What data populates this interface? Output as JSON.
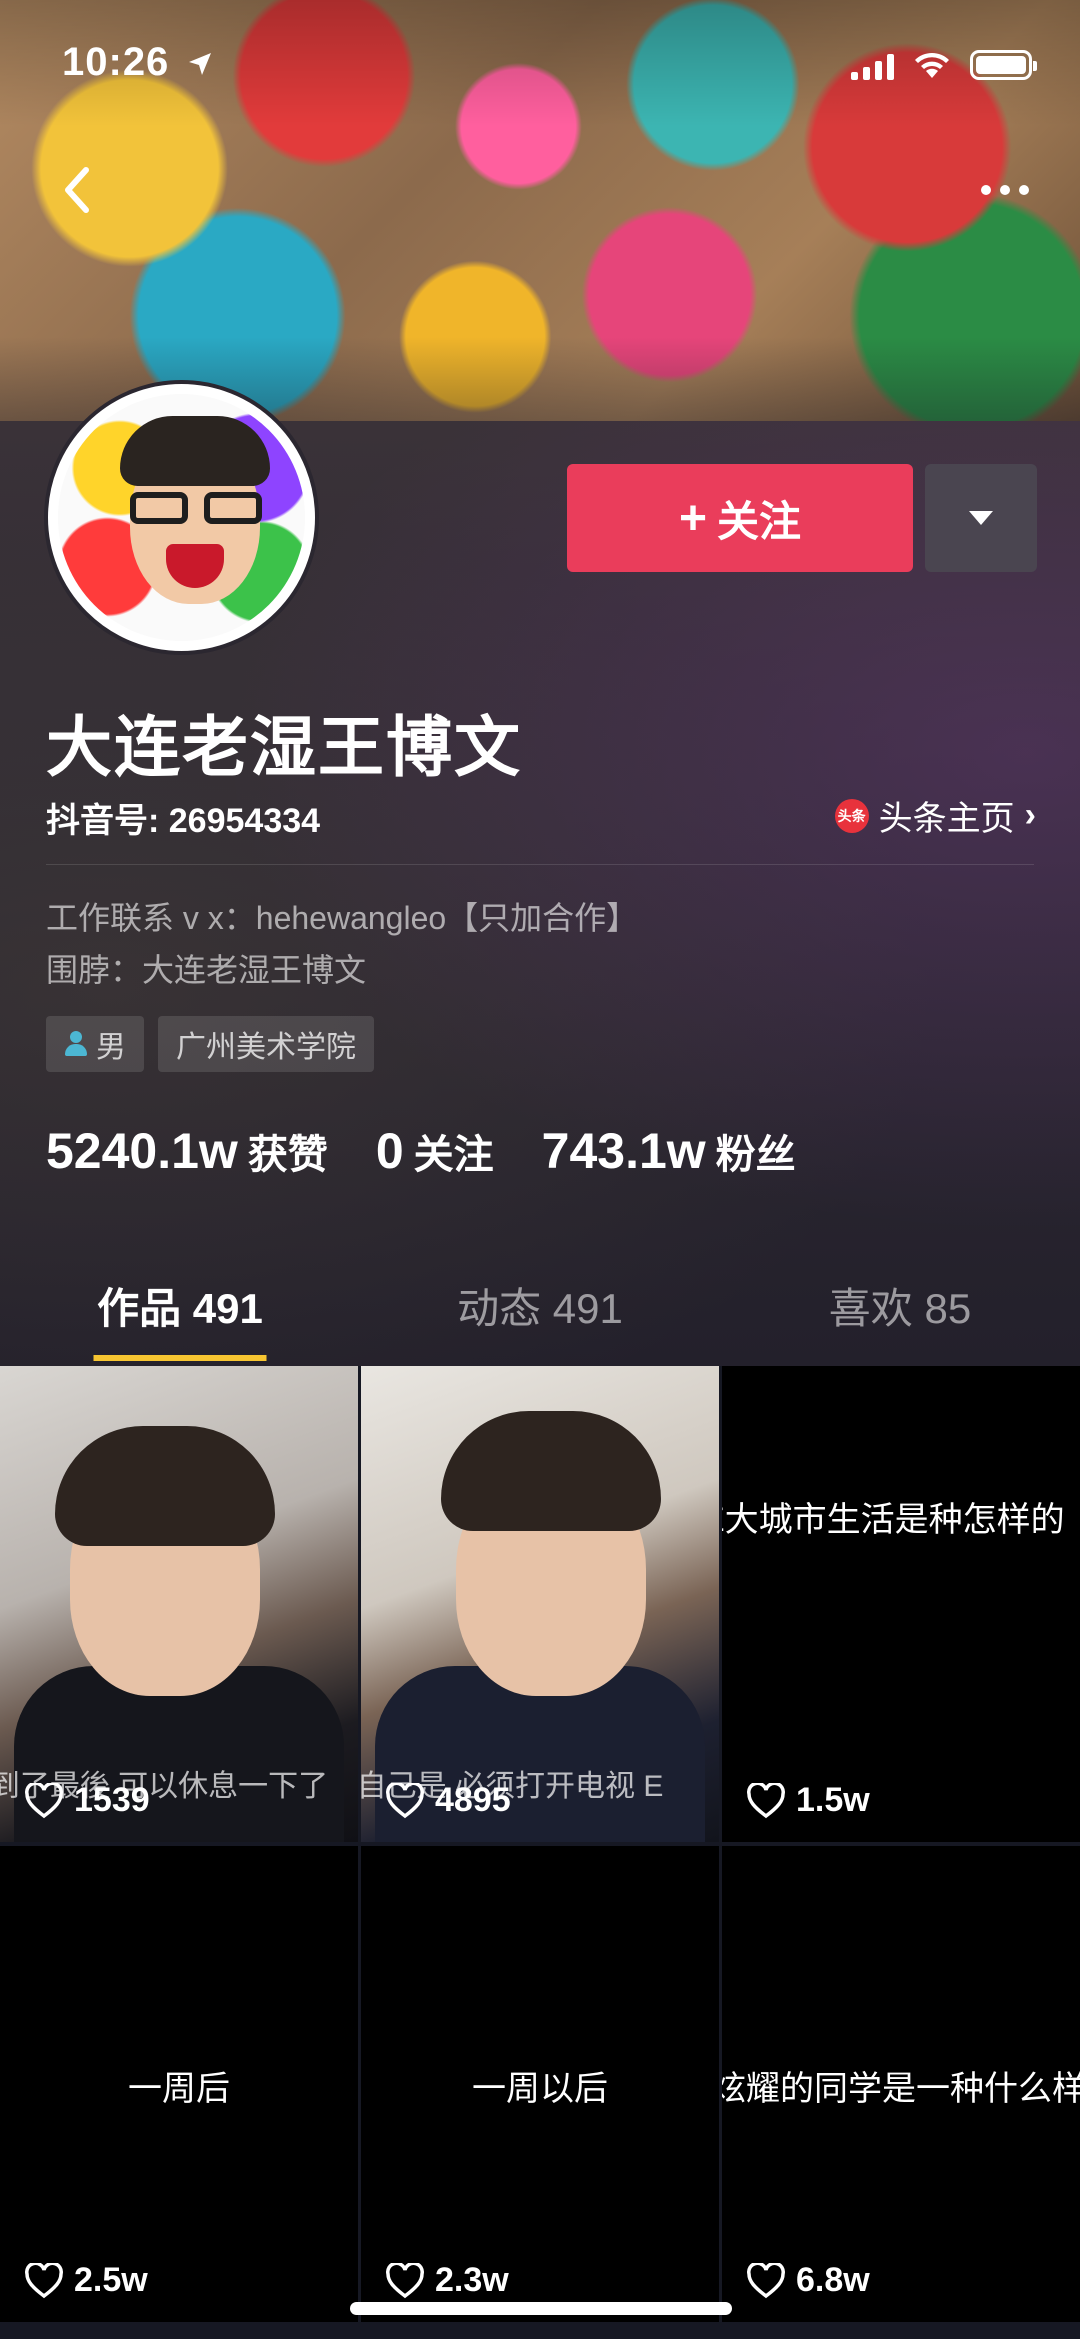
{
  "status_bar": {
    "time": "10:26"
  },
  "profile": {
    "name": "大连老湿王博文",
    "douyin_id": "抖音号: 26954334",
    "toutiao_icon_text": "头条",
    "toutiao_label": "头条主页",
    "bio_lines": [
      "工作联系 v x：hehewangleo【只加合作】",
      "围脖：大连老湿王博文"
    ],
    "tags": [
      "男",
      "广州美术学院"
    ],
    "follow_label": "关注",
    "follow_plus": "+"
  },
  "stats": [
    {
      "num": "5240.1w",
      "label": "获赞"
    },
    {
      "num": "0",
      "label": "关注"
    },
    {
      "num": "743.1w",
      "label": "粉丝"
    }
  ],
  "tabs": [
    {
      "label": "作品 491",
      "active": true
    },
    {
      "label": "动态 491",
      "active": false
    },
    {
      "label": "喜欢 85",
      "active": false
    }
  ],
  "videos": [
    {
      "likes": "1539",
      "caption": "到了最後 可以休息一下了"
    },
    {
      "likes": "4895",
      "caption": "自己是 必须打开电视 E"
    },
    {
      "likes": "1.5w",
      "caption": "E大城市生活是种怎样的"
    },
    {
      "likes": "2.5w",
      "caption": "一周后"
    },
    {
      "likes": "2.3w",
      "caption": "一周以后"
    },
    {
      "likes": "6.8w",
      "caption": "炫耀的同学是一种什么样的"
    }
  ],
  "colors": {
    "accent": "#ea3d5b",
    "tab_indicator": "#f7c531",
    "background": "#161823"
  }
}
